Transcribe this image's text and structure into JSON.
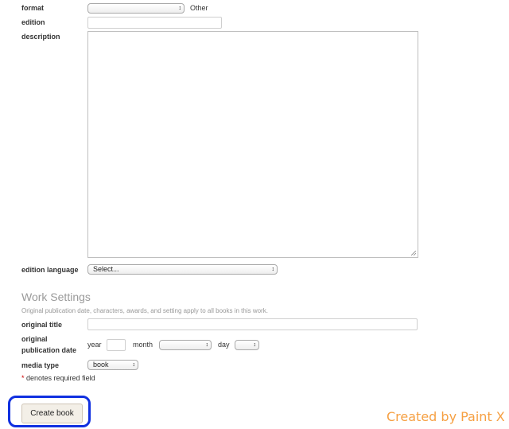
{
  "form": {
    "format": {
      "label": "format",
      "value": "",
      "other_label": "Other"
    },
    "edition": {
      "label": "edition",
      "value": ""
    },
    "description": {
      "label": "description",
      "value": ""
    },
    "edition_language": {
      "label": "edition language",
      "value": "Select..."
    }
  },
  "work_settings": {
    "title": "Work Settings",
    "description": "Original publication date, characters, awards, and setting apply to all books in this work.",
    "original_title": {
      "label": "original title",
      "value": ""
    },
    "original_publication_date": {
      "label_line1": "original",
      "label_line2": "publication date",
      "year_label": "year",
      "year_value": "",
      "month_label": "month",
      "month_value": "",
      "day_label": "day",
      "day_value": ""
    },
    "media_type": {
      "label": "media type",
      "value": "book"
    }
  },
  "required_note": {
    "star": "*",
    "text": " denotes required field"
  },
  "actions": {
    "create_label": "Create book"
  },
  "watermark": "Created by Paint X",
  "icons": {
    "select_arrows": "updown-arrows-icon",
    "resize": "resize-handle-icon"
  },
  "colors": {
    "highlight": "#1030e0",
    "watermark": "#f6a043",
    "button_bg": "#f3efe7",
    "required_star": "#cc0000"
  }
}
